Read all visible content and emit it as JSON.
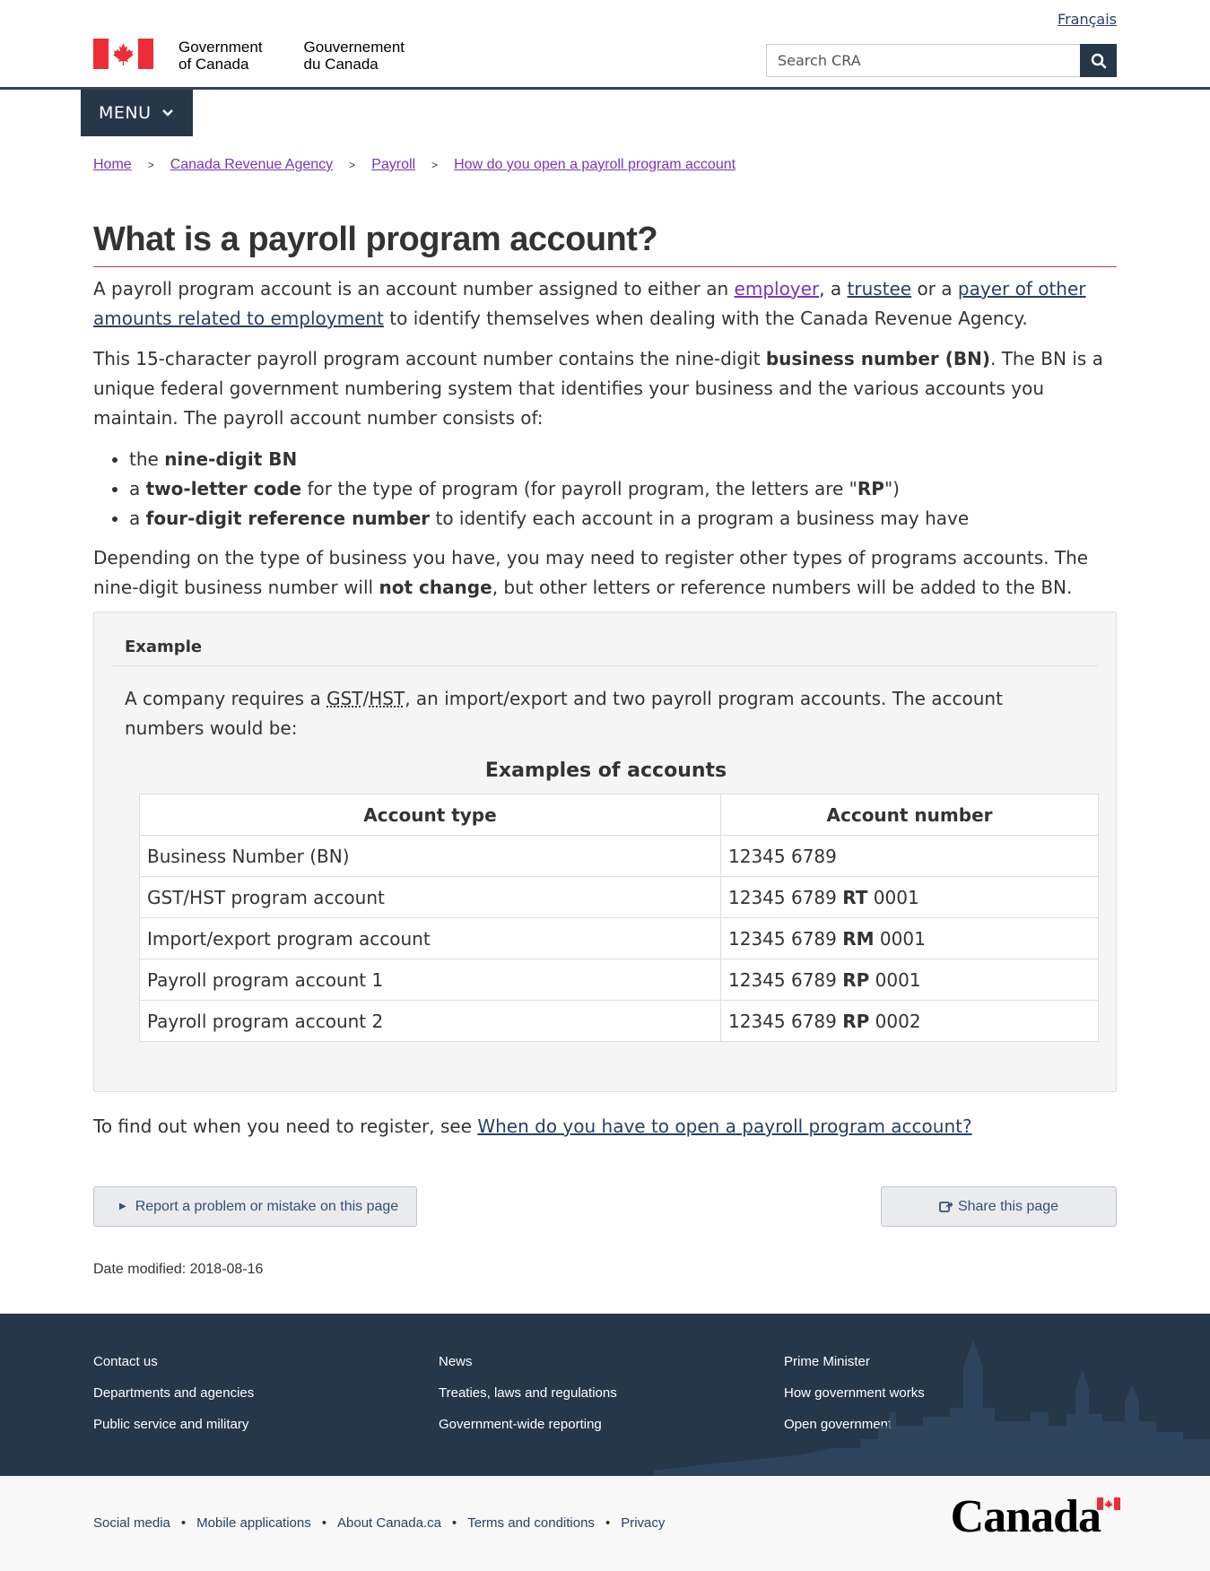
{
  "header": {
    "language_link": "Français",
    "sig_en_line1": "Government",
    "sig_en_line2": "of Canada",
    "sig_fr_line1": "Gouvernement",
    "sig_fr_line2": "du Canada",
    "search_placeholder": "Search CRA",
    "menu_label": "MENU"
  },
  "breadcrumb": [
    "Home",
    "Canada Revenue Agency",
    "Payroll",
    "How do you open a payroll program account"
  ],
  "breadcrumb_separator": ">",
  "page": {
    "title": "What is a payroll program account?",
    "p1": {
      "t1": "A payroll program account is an account number assigned to either an ",
      "link_employer": "employer",
      "t2": ", a ",
      "link_trustee": "trustee",
      "t3": " or a ",
      "link_payer": "payer of other amounts related to employment",
      "t4": " to identify themselves when dealing with the Canada Revenue Agency."
    },
    "p2": {
      "t1": "This 15-character payroll program account number contains the nine-digit ",
      "b1": "business number (BN)",
      "t2": ". The BN is a unique federal government numbering system that identifies your business and the various accounts you maintain. The payroll account number consists of:"
    },
    "list": [
      {
        "pre": "the ",
        "bold": "nine-digit BN",
        "post": ""
      },
      {
        "pre": "a ",
        "bold": "two-letter code",
        "post": " for the type of program (for payroll program, the letters are \"",
        "bold2": "RP",
        "post2": "\")"
      },
      {
        "pre": "a ",
        "bold": "four-digit reference number",
        "post": " to identify each account in a program a business may have"
      }
    ],
    "p3": {
      "t1": "Depending on the type of business you have, you may need to register other types of programs accounts. The nine-digit business number will ",
      "b1": "not change",
      "t2": ", but other letters or reference numbers will be added to the BN."
    },
    "example": {
      "heading": "Example",
      "t1": "A company requires a ",
      "abbr1": "GST",
      "slash": "/",
      "abbr2": "HST",
      "t2": ", an import/export and two payroll program accounts. The account numbers would be:",
      "table_caption": "Examples of accounts",
      "columns": [
        "Account type",
        "Account number"
      ],
      "rows": [
        {
          "type": "Business Number (BN)",
          "base": "12345 6789",
          "code": "",
          "ref": ""
        },
        {
          "type": "GST/HST program account",
          "base": "12345 6789 ",
          "code": "RT",
          "ref": " 0001"
        },
        {
          "type": "Import/export program account",
          "base": "12345 6789 ",
          "code": "RM",
          "ref": " 0001"
        },
        {
          "type": "Payroll program account 1",
          "base": "12345 6789 ",
          "code": "RP",
          "ref": " 0001"
        },
        {
          "type": "Payroll program account 2",
          "base": "12345 6789 ",
          "code": "RP",
          "ref": " 0002"
        }
      ]
    },
    "find_out": {
      "t1": "To find out when you need to register, see ",
      "link": "When do you have to open a payroll program account?"
    },
    "report_button": "Report a problem or mistake on this page",
    "share_button": "Share this page",
    "date_modified_label": "Date modified: ",
    "date_modified_value": "2018-08-16"
  },
  "footer": {
    "col1": [
      "Contact us",
      "Departments and agencies",
      "Public service and military"
    ],
    "col2": [
      "News",
      "Treaties, laws and regulations",
      "Government-wide reporting"
    ],
    "col3": [
      "Prime Minister",
      "How government works",
      "Open government"
    ],
    "sub_links": [
      "Social media",
      "Mobile applications",
      "About Canada.ca",
      "Terms and conditions",
      "Privacy"
    ],
    "wordmark": "Canada"
  },
  "colors": {
    "navy": "#26374a",
    "link": "#284162",
    "visited": "#7834bc",
    "title_rule": "#af3c43",
    "flag_red": "#eb2d37"
  }
}
